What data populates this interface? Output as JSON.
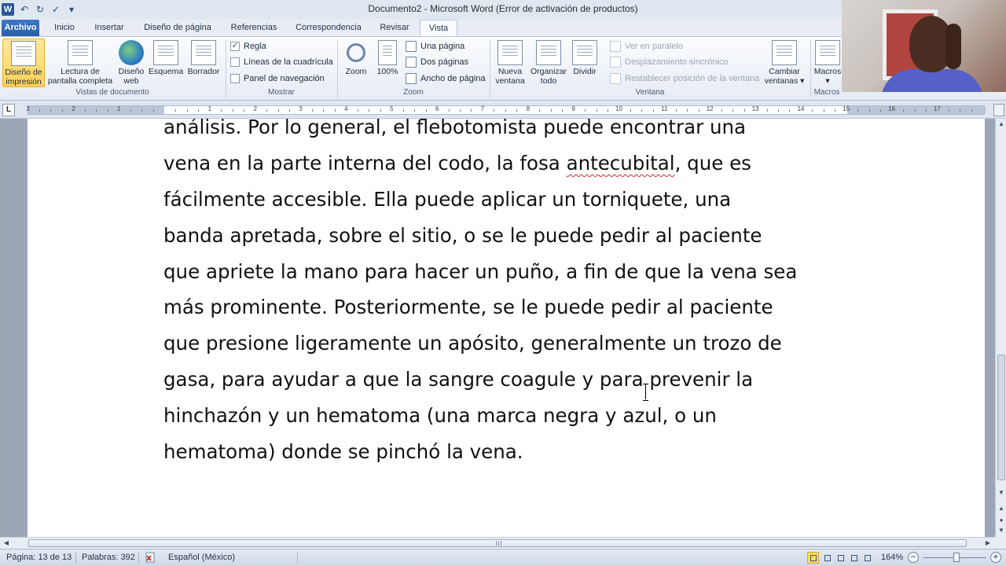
{
  "window": {
    "title": "Documento2 - Microsoft Word (Error de activación de productos)",
    "app_letter": "W"
  },
  "tabs": [
    "Archivo",
    "Inicio",
    "Insertar",
    "Diseño de página",
    "Referencias",
    "Correspondencia",
    "Revisar",
    "Vista"
  ],
  "active_tab": "Vista",
  "ribbon": {
    "vistas": {
      "group_label": "Vistas de documento",
      "impresion": [
        "Diseño de",
        "impresión"
      ],
      "lectura": [
        "Lectura de",
        "pantalla completa"
      ],
      "web": [
        "Diseño",
        "web"
      ],
      "esquema": "Esquema",
      "borrador": "Borrador"
    },
    "mostrar": {
      "group_label": "Mostrar",
      "regla": "Regla",
      "cuadricula": "Líneas de la cuadrícula",
      "navegacion": "Panel de navegación",
      "regla_checked": true
    },
    "zoom": {
      "group_label": "Zoom",
      "zoom": "Zoom",
      "pct": "100%",
      "una_pagina": "Una página",
      "dos_paginas": "Dos páginas",
      "ancho_pagina": "Ancho de página"
    },
    "ventana": {
      "group_label": "Ventana",
      "nueva": [
        "Nueva",
        "ventana"
      ],
      "organizar": [
        "Organizar",
        "todo"
      ],
      "dividir": "Dividir",
      "paralelo": "Ver en paralelo",
      "sincronico": "Desplazamiento sincrónico",
      "restablecer": "Restablecer posición de la ventana",
      "cambiar": [
        "Cambiar",
        "ventanas"
      ]
    },
    "macros": {
      "group_label": "Macros",
      "macros": "Macros"
    }
  },
  "ruler": {
    "numbers_left": [
      "3",
      "2",
      "1"
    ],
    "numbers_right": [
      "1",
      "2",
      "3",
      "4",
      "5",
      "6",
      "7",
      "8",
      "9",
      "10",
      "11",
      "12",
      "13",
      "14",
      "15",
      "16",
      "17"
    ],
    "tab_selector": "L"
  },
  "document": {
    "lines": [
      "análisis.  Por lo general, el flebotomista puede encontrar una",
      [
        "vena en la parte interna del codo, la fosa ",
        "antecubital",
        ", que es"
      ],
      "fácilmente accesible.  Ella puede aplicar un torniquete, una",
      "banda apretada, sobre el sitio, o se le puede pedir al paciente",
      "que apriete la mano para hacer un puño, a fin de que la vena sea",
      "más prominente.  Posteriormente, se le puede pedir al paciente",
      "que presione ligeramente un apósito, generalmente un trozo de",
      "gasa, para ayudar a que la sangre coagule y para prevenir la",
      "hinchazón y un hematoma (una marca negra y azul, o un",
      "hematoma) donde se pinchó la vena."
    ]
  },
  "status_bar": {
    "page": "Página: 13 de 13",
    "words": "Palabras: 392",
    "language": "Español (México)",
    "zoom": "164%",
    "zoom_fraction": 0.52
  }
}
